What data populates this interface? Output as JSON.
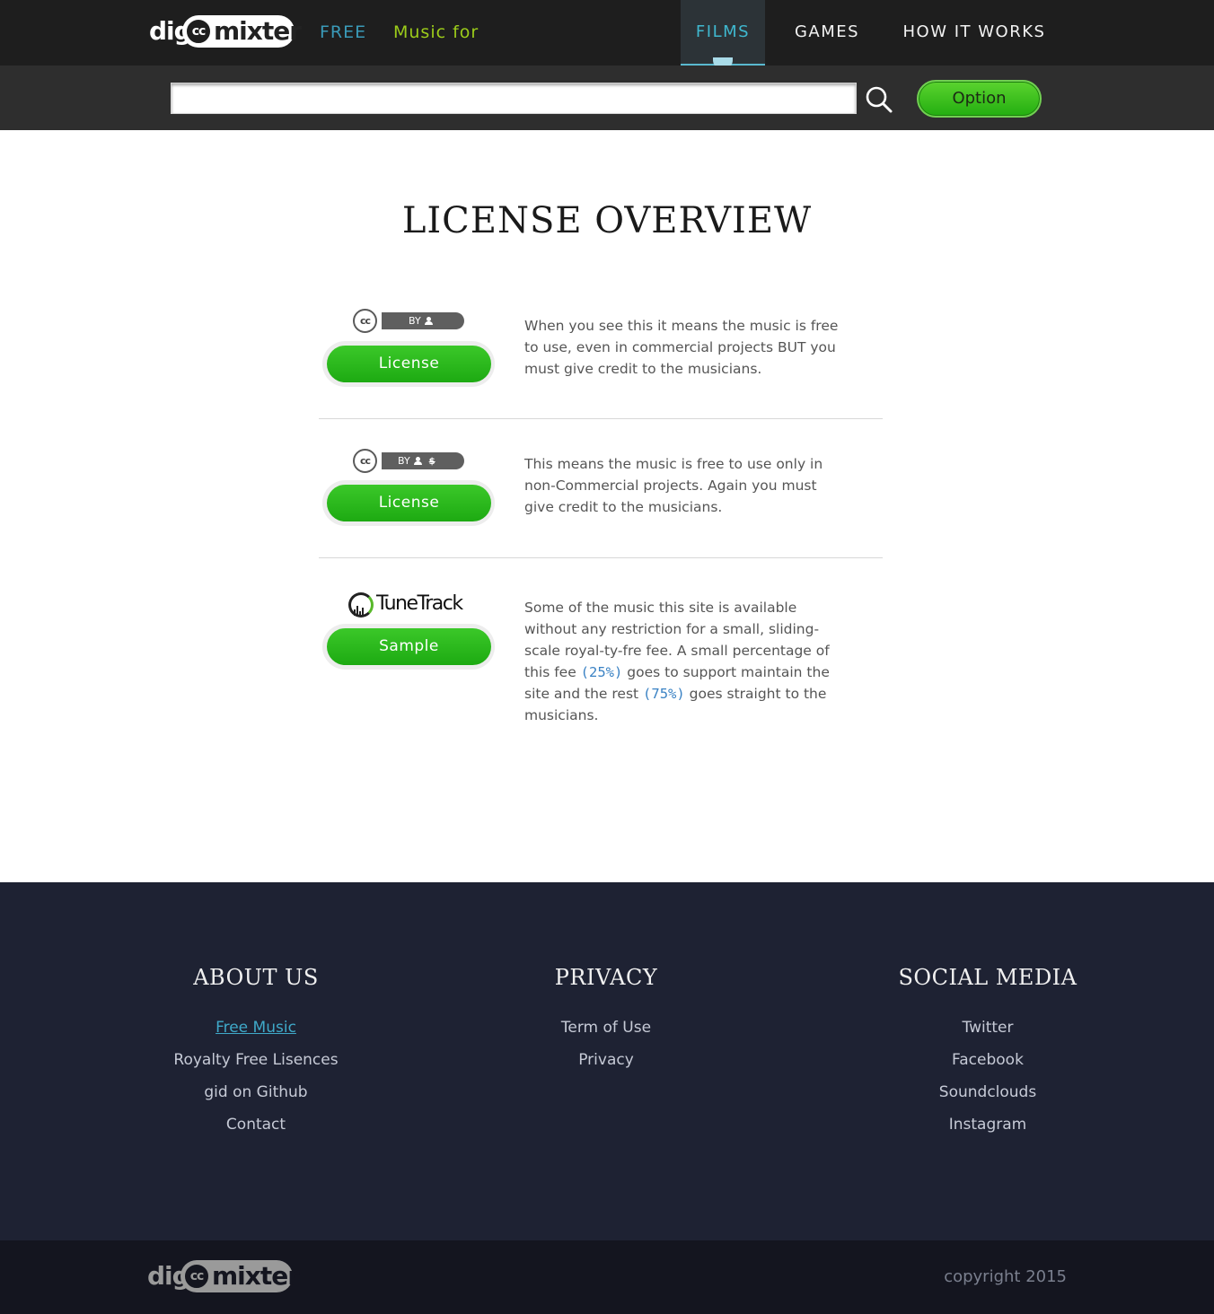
{
  "nav": {
    "logo_dig": "dig",
    "logo_cc": "cc",
    "logo_mixter": "mixter",
    "free": "FREE",
    "music_for": "Music for",
    "films": "FILMS",
    "games": "GAMES",
    "how_it_works": "HOW IT WORKS"
  },
  "search": {
    "value": "",
    "placeholder": "",
    "option_label": "Option"
  },
  "main": {
    "title": "LICENSE OVERVIEW",
    "licenses": [
      {
        "badge_cc": "cc",
        "badge_by": "BY",
        "button": "License",
        "text": "When you see this it means the music is free to use, even in commercial projects BUT you must give credit to the musicians."
      },
      {
        "badge_cc": "cc",
        "badge_by": "BY",
        "button": "License",
        "text": "This means the music is free to use only in non-Commercial projects. Again you must give credit to the musicians."
      },
      {
        "brand": "TuneTrack",
        "button": "Sample",
        "text_a": "Some of the music this site is available without any restriction for a small, sliding-scale royal-ty-fre fee. A small percentage of this fee ",
        "pct_site": "(25%)",
        "text_b": " goes to support maintain the site and the rest ",
        "pct_musicians": "(75%)",
        "text_c": " goes straight to the musicians."
      }
    ]
  },
  "footer": {
    "about": {
      "title": "ABOUT US",
      "links": [
        "Free Music",
        "Royalty Free Lisences",
        "gid on Github",
        "Contact"
      ]
    },
    "privacy": {
      "title": "PRIVACY",
      "links": [
        "Term of Use",
        "Privacy"
      ]
    },
    "social": {
      "title": "SOCIAL MEDIA",
      "links": [
        "Twitter",
        "Facebook",
        "Soundclouds",
        "Instagram"
      ]
    },
    "copyright": "copyright 2015"
  },
  "colors": {
    "topbar": "#1e1e1e",
    "accent_blue": "#3fb8cf",
    "accent_green": "#9ccc1a",
    "button_green": "#23ae10",
    "footer": "#1e2233",
    "bottombar": "#14151f"
  },
  "icons": {
    "search": "search-icon",
    "cc": "creative-commons-icon",
    "by": "attribution-person-icon",
    "nc": "non-commercial-icon",
    "tunetrack": "tunetrack-logo"
  }
}
